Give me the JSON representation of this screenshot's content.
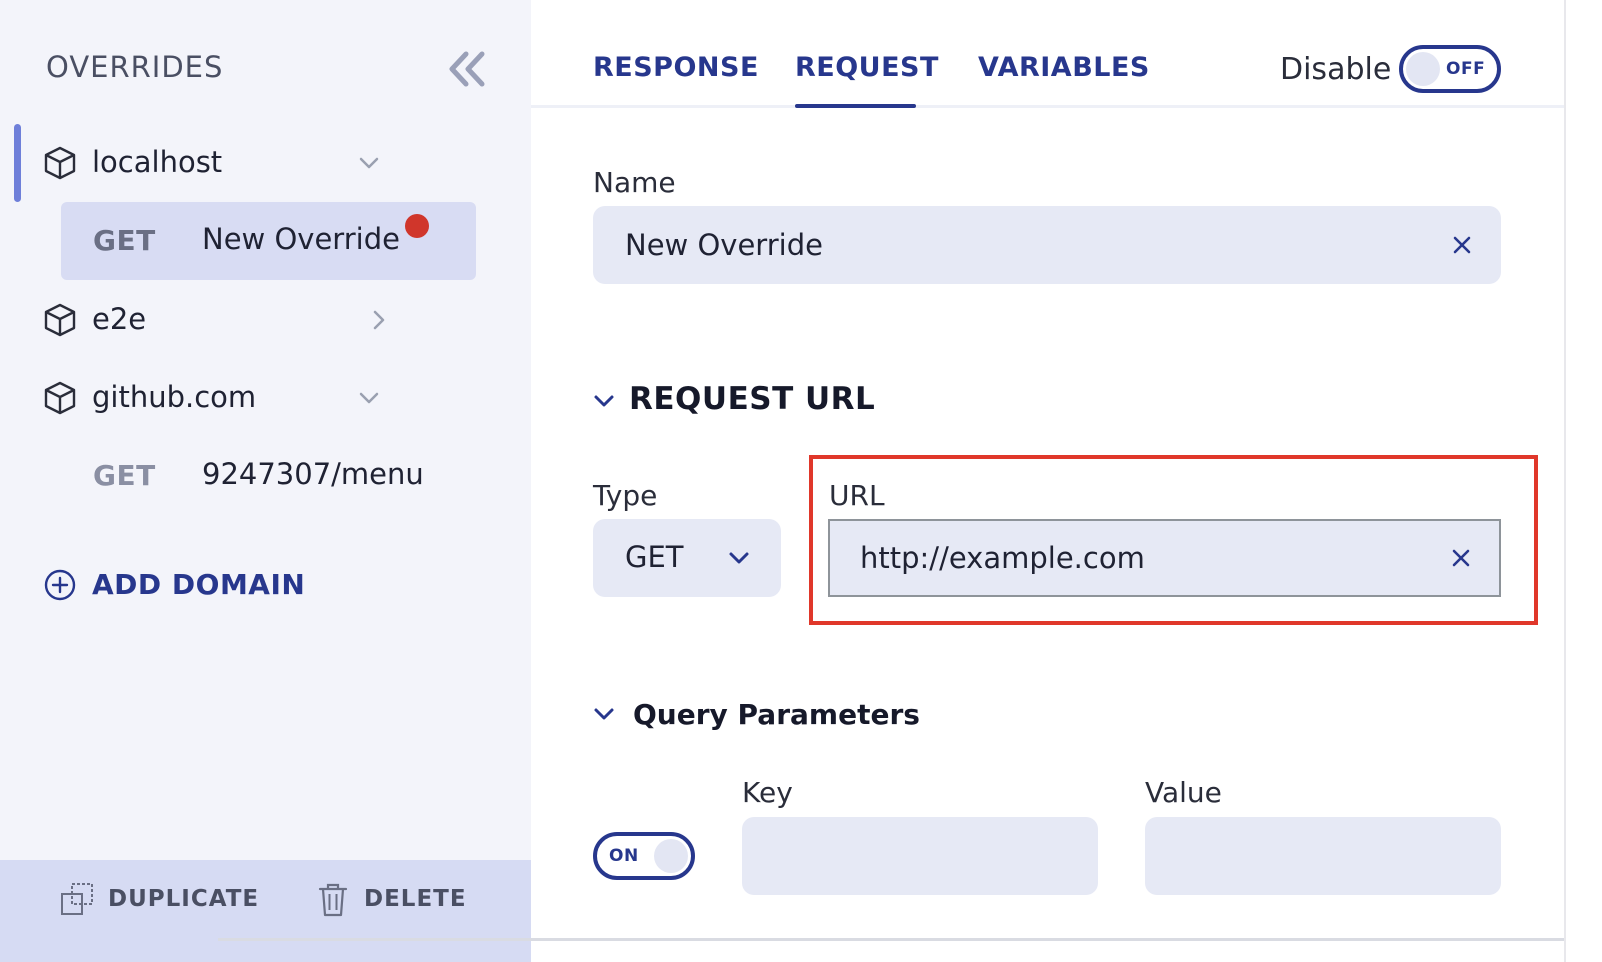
{
  "sidebar": {
    "title": "OVERRIDES",
    "domains": [
      {
        "label": "localhost",
        "expanded": true,
        "routes": [
          {
            "method": "GET",
            "name": "New Override",
            "selected": true,
            "unsaved": true
          }
        ]
      },
      {
        "label": "e2e",
        "expanded": false,
        "routes": []
      },
      {
        "label": "github.com",
        "expanded": true,
        "routes": [
          {
            "method": "GET",
            "name": "9247307/menu",
            "selected": false
          }
        ]
      }
    ],
    "add_domain_label": "ADD DOMAIN",
    "footer": {
      "duplicate_label": "DUPLICATE",
      "delete_label": "DELETE"
    }
  },
  "tabs": [
    {
      "label": "RESPONSE",
      "active": false
    },
    {
      "label": "REQUEST",
      "active": true
    },
    {
      "label": "VARIABLES",
      "active": false
    }
  ],
  "disable": {
    "label": "Disable",
    "state": "OFF"
  },
  "form": {
    "name": {
      "label": "Name",
      "value": "New Override"
    },
    "request_url": {
      "section_title": "REQUEST URL",
      "type": {
        "label": "Type",
        "value": "GET"
      },
      "url": {
        "label": "URL",
        "value": "http://example.com"
      }
    },
    "query_params": {
      "section_title": "Query Parameters",
      "toggle_state": "ON",
      "key_label": "Key",
      "value_label": "Value",
      "key_value": "",
      "value_value": ""
    }
  },
  "colors": {
    "accent": "#27378d",
    "highlight": "#e0372a",
    "unsaved_dot": "#d0362b",
    "selected_row": "#d8dcf3"
  }
}
